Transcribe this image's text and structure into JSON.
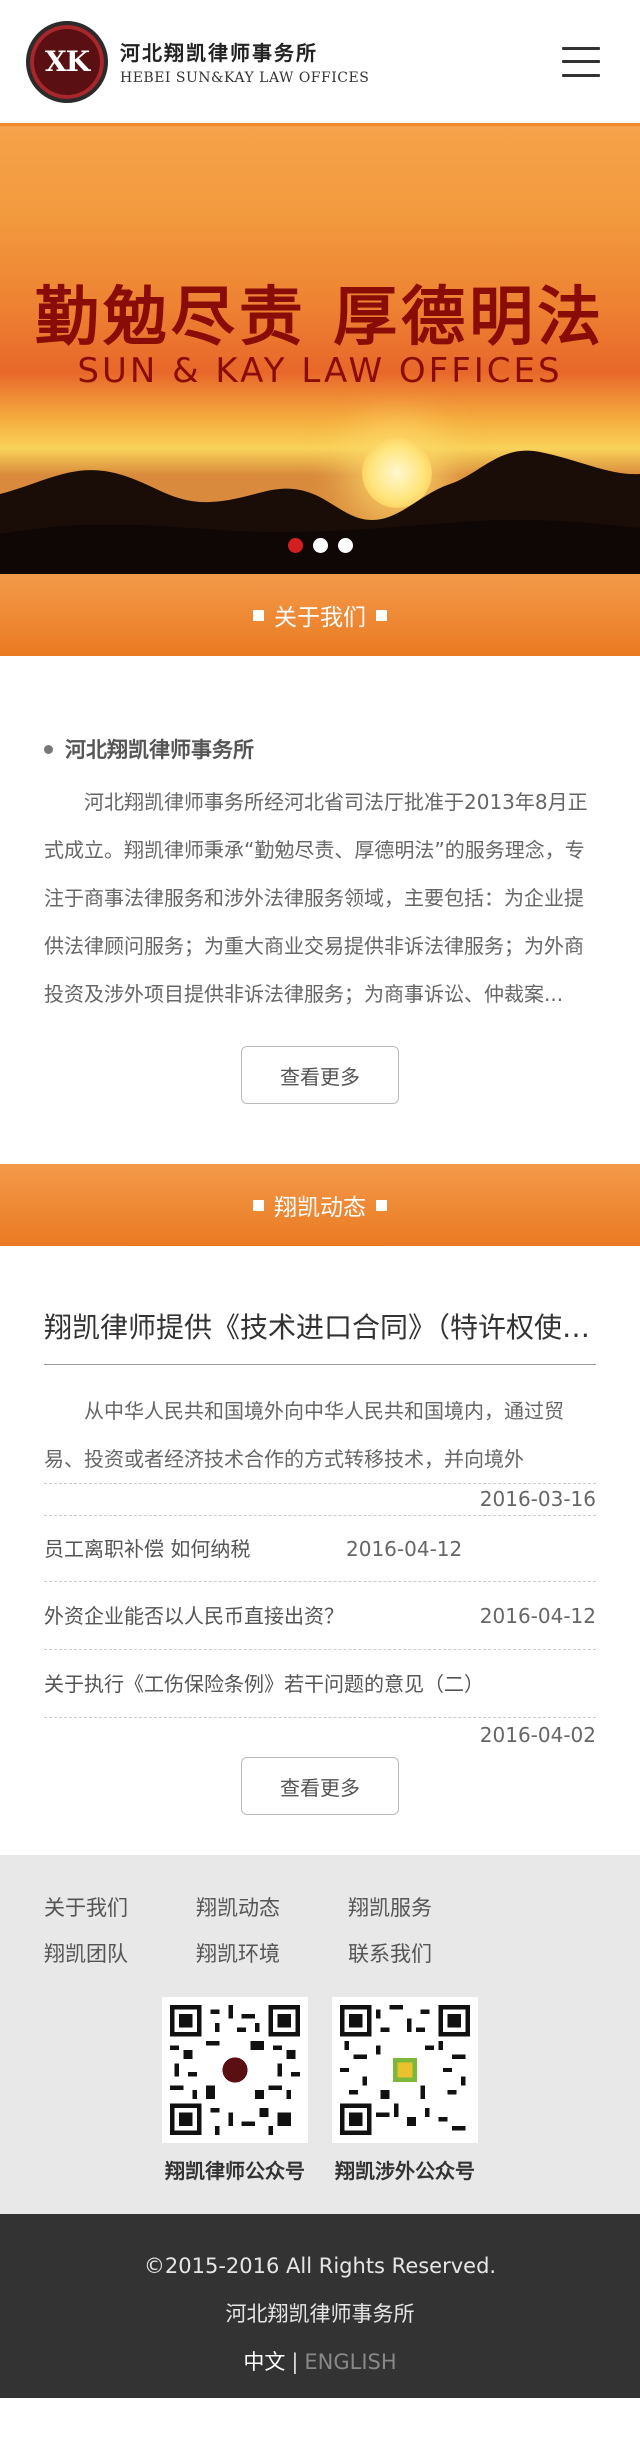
{
  "header": {
    "logo_mark": "XK",
    "name_cn": "河北翔凯律师事务所",
    "name_en": "HEBEI SUN&KAY LAW OFFICES"
  },
  "banner": {
    "slogan_cn": "勤勉尽责  厚德明法",
    "slogan_en": "SUN & KAY  LAW  OFFICES",
    "slides": 3,
    "active_slide": 1
  },
  "about": {
    "section_title": "关于我们",
    "firm_name": "河北翔凯律师事务所",
    "text": "河北翔凯律师事务所经河北省司法厅批准于2013年8月正式成立。翔凯律师秉承“勤勉尽责、厚德明法”的服务理念，专注于商事法律服务和涉外法律服务领域，主要包括：为企业提供法律顾问服务；为重大商业交易提供非诉法律服务；为外商投资及涉外项目提供非诉法律服务；为商事诉讼、仲裁案...",
    "more_label": "查看更多"
  },
  "news": {
    "section_title": "翔凯动态",
    "headline": "翔凯律师提供《技术进口合同》（特许权使用费）",
    "intro": "从中华人民共和国境外向中华人民共和国境内，通过贸易、投资或者经济技术合作的方式转移技术，并向境外",
    "items": [
      {
        "title": "",
        "date": "2016-03-16"
      },
      {
        "title": "员工离职补偿 如何纳税",
        "date": "2016-04-12"
      },
      {
        "title": "外资企业能否以人民币直接出资？",
        "date": "2016-04-12"
      },
      {
        "title": "关于执行《工伤保险条例》若干问题的意见（二）",
        "date": ""
      },
      {
        "title": "",
        "date": "2016-04-02"
      }
    ],
    "more_label": "查看更多"
  },
  "footer": {
    "links": [
      "关于我们",
      "翔凯动态",
      "翔凯服务",
      "翔凯团队",
      "翔凯环境",
      "联系我们"
    ],
    "qr_codes": [
      {
        "label": "翔凯律师公众号"
      },
      {
        "label": "翔凯涉外公众号"
      }
    ]
  },
  "bottom": {
    "copyright": "©2015-2016 All Rights Reserved.",
    "company": "河北翔凯律师事务所",
    "lang_cn": "中文",
    "lang_sep": "|",
    "lang_en": "ENGLISH"
  },
  "colors": {
    "accent": "#f08a2c",
    "active_dot": "#d31f1f",
    "bottom_bg": "#333333",
    "footer_bg": "#e8e8e8"
  }
}
